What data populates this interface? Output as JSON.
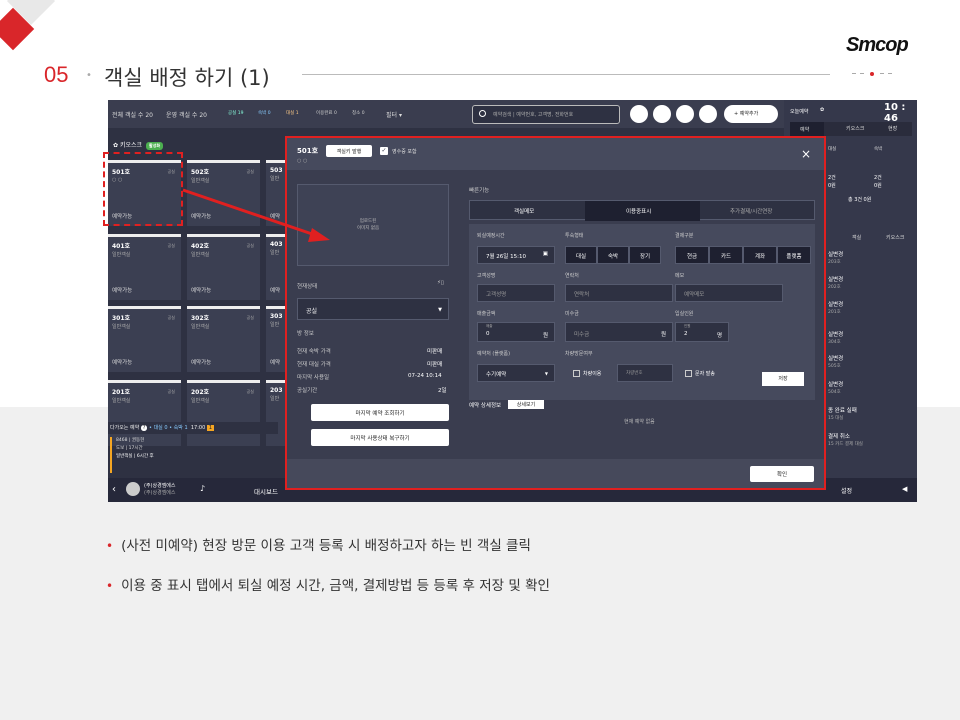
{
  "slide": {
    "section_number": "05",
    "section_title": "객실 배정 하기 (1)",
    "logo": "Smcop",
    "bullets": [
      "(사전 미예약) 현장 방문 이용 고객 등록 시 배정하고자 하는 빈 객실 클릭",
      "이용  중 표시 탭에서 퇴실 예정 시간, 금액, 결제방법 등 등록 후 저장 및 확인"
    ],
    "colors": {
      "accent": "#d9262a",
      "app_bg": "#2e3142",
      "highlight_box": "#e02020"
    }
  },
  "app": {
    "topbar": {
      "total_rooms": "전체 객실 수 20",
      "operating_rooms": "운영 객실 수 20",
      "status_counts": [
        "공실 19",
        "숙박 0",
        "대실 1",
        "이용완료 0",
        "청소 0"
      ],
      "filter_label": "필터 ▾",
      "search_placeholder": "예약검색 | 예약번호, 고객명, 전화번호",
      "add_reservation": "+ 예약추가"
    },
    "kiosk_label": "키오스크",
    "kiosk_badge": "활성화",
    "rooms": [
      {
        "no": "501호",
        "type": "일반객실",
        "status_small": "공실",
        "sub": "○ ○",
        "state": "예약가능"
      },
      {
        "no": "502호",
        "type": "일반객실",
        "status_small": "공실",
        "state": "예약가능"
      },
      {
        "no": "503",
        "type": "일반",
        "state": "예약"
      },
      {
        "no": "401호",
        "type": "일반객실",
        "status_small": "공실",
        "state": "예약가능"
      },
      {
        "no": "402호",
        "type": "일반객실",
        "status_small": "공실",
        "state": "예약가능"
      },
      {
        "no": "403",
        "type": "일반",
        "state": "예약"
      },
      {
        "no": "301호",
        "type": "일반객실",
        "status_small": "공실",
        "state": "예약가능"
      },
      {
        "no": "302호",
        "type": "일반객실",
        "status_small": "공실",
        "state": "예약가능"
      },
      {
        "no": "303",
        "type": "일반",
        "state": "예약"
      },
      {
        "no": "201호",
        "type": "일반객실",
        "status_small": "공실",
        "state": "예약가능"
      },
      {
        "no": "202호",
        "type": "일반객실",
        "status_small": "공실",
        "state": "예약가능"
      },
      {
        "no": "203",
        "type": "일반",
        "state": "예약"
      }
    ],
    "upcoming": {
      "label": "다가오는 예약",
      "count_badge": "?",
      "stay_info": "• 대실 0 • 숙박 1",
      "time": "17:00",
      "badge": "1"
    },
    "reservation_info": [
      "8468 | 권동현",
      "도보 | 17시간",
      "일반객실 | 6시간 후"
    ],
    "bottom": {
      "company": "(주)상경엠에스",
      "company_sub": "(주)상경엠에스",
      "dashboard": "대시보드",
      "settings": "설정"
    },
    "right_panel": {
      "today": "오늘예약",
      "clock": "10 : 46",
      "tabs": [
        "예약",
        "키오스크",
        "현장"
      ],
      "cols": [
        "대실",
        "숙박"
      ],
      "counts": [
        "2건",
        "2건"
      ],
      "counts2": [
        "0원",
        "0원"
      ],
      "total": "총 3건 0원",
      "tabs2": [
        "객실",
        "키오스크"
      ],
      "events": [
        {
          "title": "실변경",
          "sub": "203호"
        },
        {
          "title": "실변경",
          "sub": "202호"
        },
        {
          "title": "실변경",
          "sub": "201호"
        },
        {
          "title": "실변경",
          "sub": "304호"
        },
        {
          "title": "실변경",
          "sub": "505호"
        },
        {
          "title": "실변경",
          "sub": "504호"
        },
        {
          "title": "종 완료 실패",
          "sub": "15   대실"
        },
        {
          "title": "결제 취소",
          "sub": "15   카드 결제   대실"
        }
      ]
    },
    "modal": {
      "room": "501호",
      "room_sub": "○ ○",
      "key_button": "객실키 발행",
      "receipt_label": "영수증 포함",
      "close": "×",
      "image_placeholder": [
        "업로드된",
        "이미지 없음"
      ],
      "current_status_label": "현재상태",
      "current_status": "공실",
      "room_info_label": "방 정보",
      "info_rows": [
        {
          "k": "현재 숙박 가격",
          "v": "미판매"
        },
        {
          "k": "현재 대실 가격",
          "v": "미판매"
        },
        {
          "k": "마지막 사용일",
          "v": "07-24 10:14"
        },
        {
          "k": "공실기간",
          "v": "2일"
        }
      ],
      "btn_last_reservation": "마지막 예약 조회하기",
      "btn_restore": "마지막 사용상태 복구하기",
      "quick_label": "빠른기능",
      "func_tabs": [
        "객실메모",
        "이용중표시",
        "추가결제/시간연장"
      ],
      "checkout_label": "퇴실예정시간",
      "checkout_value": "7월 26일 15:10",
      "stay_type_label": "투숙형태",
      "stay_types": [
        "대실",
        "숙박",
        "장기"
      ],
      "payment_label": "결제구분",
      "payments": [
        "현금",
        "카드",
        "계좌",
        "플랫폼"
      ],
      "name_label": "고객성명",
      "name_ph": "고객성명",
      "phone_label": "연락처",
      "phone_ph": "연락처",
      "memo_label": "메모",
      "memo_ph": "예약메모",
      "amount_label": "매출금액",
      "amount_sub": "매출",
      "amount_value": "0",
      "won": "원",
      "unpaid_label": "미수금",
      "unpaid_ph": "미수금",
      "guests_label": "입실인원",
      "guests_sub": "인원",
      "guests_value": "2",
      "guests_unit": "명",
      "reservation_label": "예약처 (플랫폼)",
      "reservation_value": "수기예약",
      "car_label": "차량방문여부",
      "car_option": "차량이용",
      "car_ph": "차량번호",
      "sms_option": "문자 발송",
      "save": "저장",
      "detail_label": "예약 상세정보",
      "detail_btn": "상세보기",
      "empty": "현재 예약 없음",
      "ok": "확인"
    }
  }
}
